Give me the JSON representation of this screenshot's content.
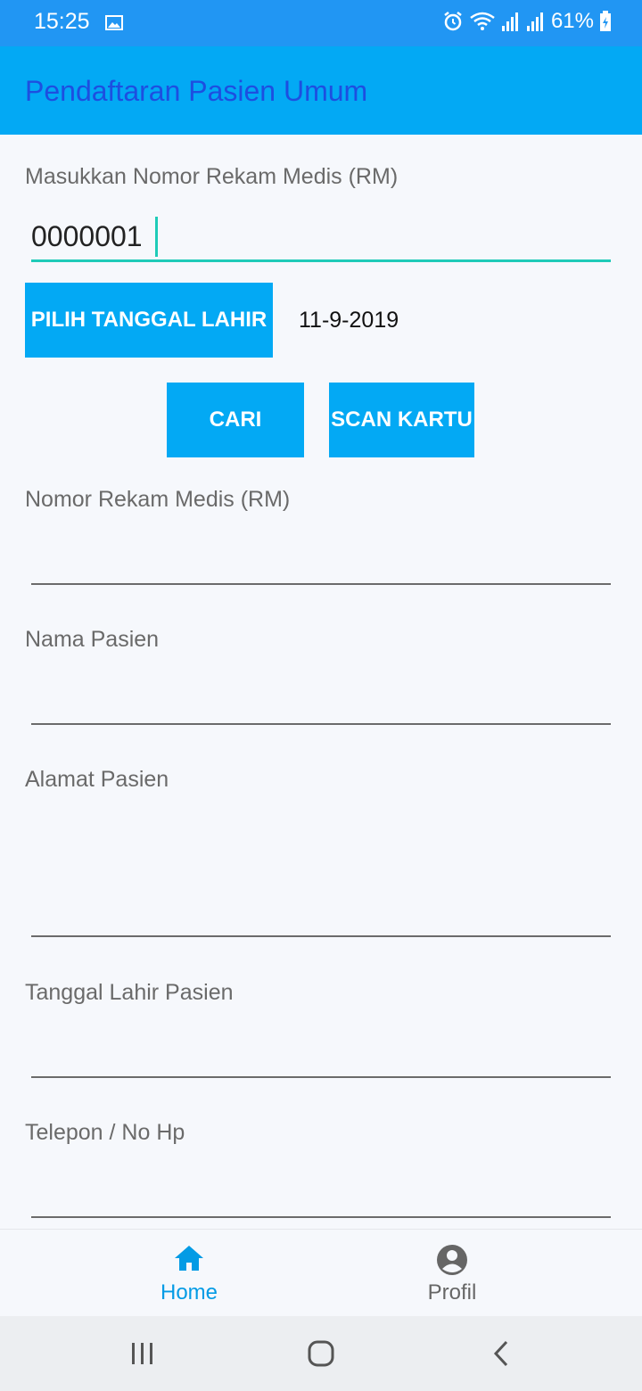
{
  "status_bar": {
    "time": "15:25",
    "battery_percent": "61%",
    "icons": [
      "gallery-icon",
      "alarm-icon",
      "wifi-icon",
      "signal-icon",
      "signal-icon",
      "battery-icon"
    ]
  },
  "app_bar": {
    "title": "Pendaftaran Pasien Umum"
  },
  "search": {
    "rm_label": "Masukkan Nomor Rekam Medis (RM)",
    "rm_value": "0000001",
    "birthdate_button": "PILIH TANGGAL LAHIR",
    "birthdate_value": "11-9-2019",
    "search_button": "CARI",
    "scan_button": "SCAN KARTU"
  },
  "result_fields": [
    {
      "label": "Nomor Rekam Medis (RM)",
      "value": ""
    },
    {
      "label": "Nama Pasien",
      "value": ""
    },
    {
      "label": "Alamat Pasien",
      "value": ""
    },
    {
      "label": "Tanggal Lahir Pasien",
      "value": ""
    },
    {
      "label": "Telepon / No Hp",
      "value": ""
    }
  ],
  "bottom_nav": {
    "items": [
      {
        "label": "Home",
        "icon": "home-icon",
        "active": true
      },
      {
        "label": "Profil",
        "icon": "account-circle-icon",
        "active": false
      }
    ]
  },
  "colors": {
    "status_bar": "#2196f3",
    "app_bar": "#03a9f4",
    "title_text": "#1d4fe0",
    "button": "#03a9f4",
    "input_focus": "#1fcbb8",
    "nav_active": "#039be5",
    "nav_inactive": "#666666"
  }
}
